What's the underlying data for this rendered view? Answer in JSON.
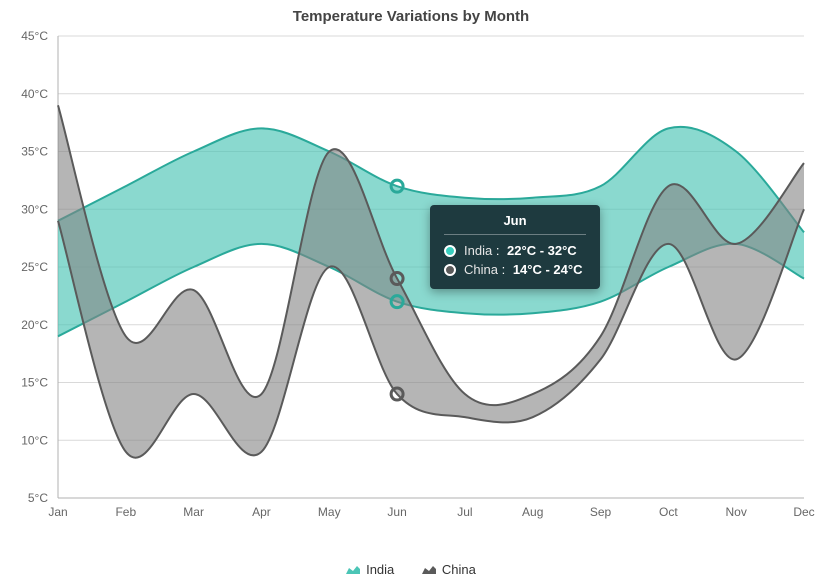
{
  "title": "Temperature Variations by Month",
  "legend": {
    "india": "India",
    "china": "China"
  },
  "colors": {
    "india_fill": "#4bc5b6",
    "india_stroke": "#2aa99a",
    "china_fill": "#838383",
    "china_stroke": "#5a5a5a",
    "tooltip_bg": "#1e3a3f"
  },
  "tooltip": {
    "title": "Jun",
    "rows": [
      {
        "label": "India",
        "value": "22°C - 32°C",
        "dot": "#3bcfbf"
      },
      {
        "label": "China",
        "value": "14°C - 24°C",
        "dot": "#5a5a5a"
      }
    ]
  },
  "chart_data": {
    "type": "area",
    "title": "Temperature Variations by Month",
    "xlabel": "",
    "ylabel": "",
    "ylim": [
      5,
      45
    ],
    "y_ticks": [
      "5°C",
      "10°C",
      "15°C",
      "20°C",
      "25°C",
      "30°C",
      "35°C",
      "40°C",
      "45°C"
    ],
    "categories": [
      "Jan",
      "Feb",
      "Mar",
      "Apr",
      "May",
      "Jun",
      "Jul",
      "Aug",
      "Sep",
      "Oct",
      "Nov",
      "Dec"
    ],
    "series": [
      {
        "name": "India",
        "low": [
          19,
          22,
          25,
          27,
          25,
          22,
          21,
          21,
          22,
          25,
          27,
          24
        ],
        "high": [
          29,
          32,
          35,
          37,
          35,
          32,
          31,
          31,
          32,
          37,
          35,
          28
        ]
      },
      {
        "name": "China",
        "low": [
          29,
          9,
          14,
          9,
          25,
          14,
          12,
          12,
          17,
          27,
          17,
          30
        ],
        "high": [
          39,
          19,
          23,
          14,
          35,
          24,
          14,
          14,
          19,
          32,
          27,
          34
        ]
      }
    ],
    "legend_position": "bottom",
    "grid": true
  }
}
